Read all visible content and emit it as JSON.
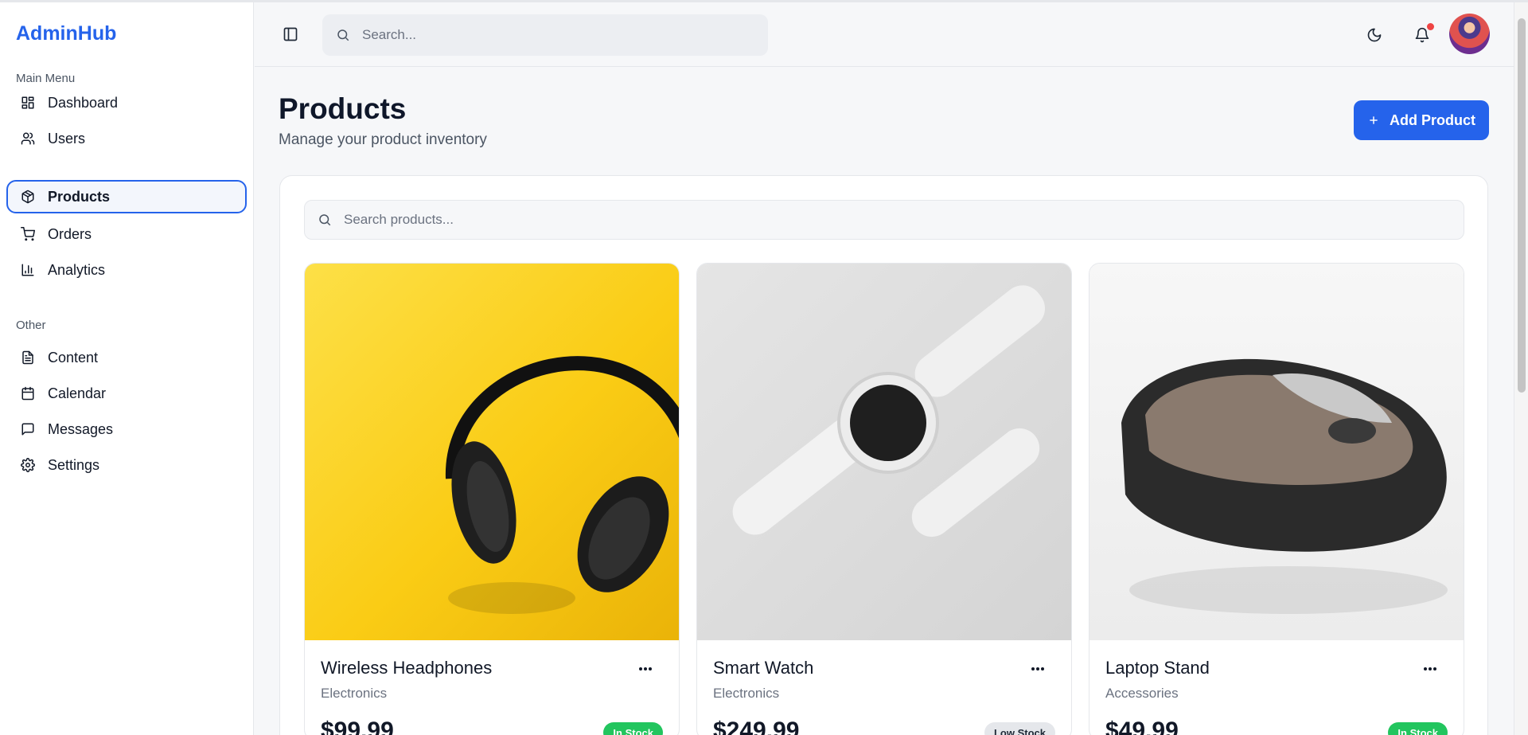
{
  "app": {
    "brand": "AdminHub"
  },
  "sidebar": {
    "main_title": "Main Menu",
    "main_items": [
      {
        "label": "Dashboard",
        "icon": "dashboard-icon",
        "active": false
      },
      {
        "label": "Users",
        "icon": "users-icon",
        "active": false
      },
      {
        "label": "Products",
        "icon": "package-icon",
        "active": true
      },
      {
        "label": "Orders",
        "icon": "cart-icon",
        "active": false
      },
      {
        "label": "Analytics",
        "icon": "bar-chart-icon",
        "active": false
      }
    ],
    "other_title": "Other",
    "other_items": [
      {
        "label": "Content",
        "icon": "file-text-icon"
      },
      {
        "label": "Calendar",
        "icon": "calendar-icon"
      },
      {
        "label": "Messages",
        "icon": "message-icon"
      },
      {
        "label": "Settings",
        "icon": "gear-icon"
      }
    ]
  },
  "header": {
    "search_placeholder": "Search...",
    "has_notification": true
  },
  "page": {
    "title": "Products",
    "subtitle": "Manage your product inventory",
    "add_button": "Add Product",
    "product_search_placeholder": "Search products..."
  },
  "products": [
    {
      "name": "Wireless Headphones",
      "category": "Electronics",
      "price": "$99.99",
      "status": "In Stock",
      "status_color": "#22c55e",
      "image": "headphones-image"
    },
    {
      "name": "Smart Watch",
      "category": "Electronics",
      "price": "$249.99",
      "status": "Low Stock",
      "status_color": "#e5e7eb",
      "image": "smart-watch-image"
    },
    {
      "name": "Laptop Stand",
      "category": "Accessories",
      "price": "$49.99",
      "status": "In Stock",
      "status_color": "#22c55e",
      "image": "mouse-image"
    }
  ],
  "colors": {
    "accent": "#2563eb",
    "success": "#22c55e",
    "danger": "#ef4444"
  }
}
